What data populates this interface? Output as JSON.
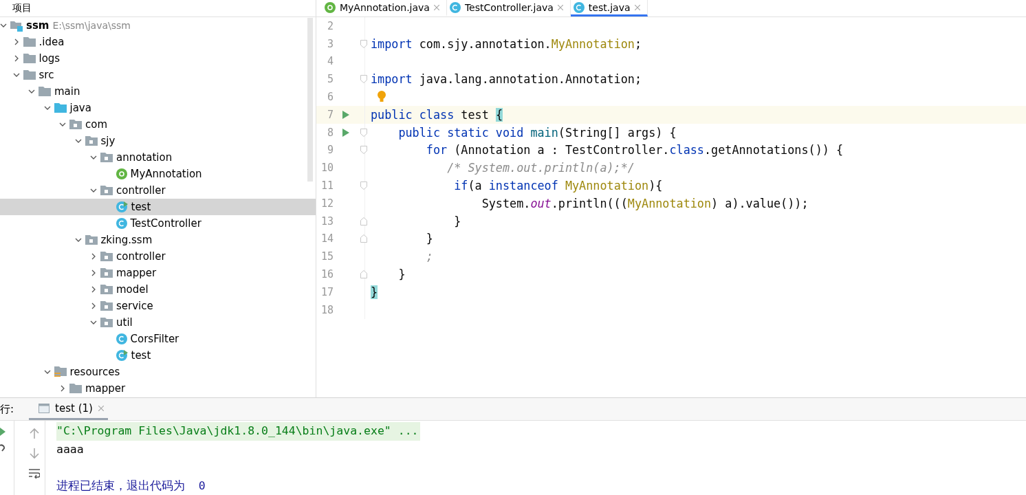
{
  "project_panel": {
    "title": "项目",
    "tree": [
      {
        "label": "ssm",
        "path": "E:\\ssm\\java\\ssm",
        "kind": "module",
        "expanded": true,
        "selected": false,
        "children": [
          {
            "label": ".idea",
            "kind": "folder",
            "expanded": false,
            "selected": false
          },
          {
            "label": "logs",
            "kind": "folder",
            "expanded": false,
            "selected": false
          },
          {
            "label": "src",
            "kind": "folder",
            "expanded": true,
            "selected": false,
            "children": [
              {
                "label": "main",
                "kind": "folder",
                "expanded": true,
                "selected": false,
                "children": [
                  {
                    "label": "java",
                    "kind": "source",
                    "expanded": true,
                    "selected": false,
                    "children": [
                      {
                        "label": "com",
                        "kind": "package",
                        "expanded": true,
                        "selected": false,
                        "children": [
                          {
                            "label": "sjy",
                            "kind": "package",
                            "expanded": true,
                            "selected": false,
                            "children": [
                              {
                                "label": "annotation",
                                "kind": "package",
                                "expanded": true,
                                "selected": false,
                                "children": [
                                  {
                                    "label": "MyAnnotation",
                                    "kind": "annotation",
                                    "selected": false
                                  }
                                ]
                              },
                              {
                                "label": "controller",
                                "kind": "package",
                                "expanded": true,
                                "selected": false,
                                "children": [
                                  {
                                    "label": "test",
                                    "kind": "runclass",
                                    "selected": true
                                  },
                                  {
                                    "label": "TestController",
                                    "kind": "class",
                                    "selected": false
                                  }
                                ]
                              }
                            ]
                          },
                          {
                            "label": "zking.ssm",
                            "kind": "package",
                            "expanded": true,
                            "selected": false,
                            "children": [
                              {
                                "label": "controller",
                                "kind": "package",
                                "expanded": false,
                                "selected": false
                              },
                              {
                                "label": "mapper",
                                "kind": "package",
                                "expanded": false,
                                "selected": false
                              },
                              {
                                "label": "model",
                                "kind": "package",
                                "expanded": false,
                                "selected": false
                              },
                              {
                                "label": "service",
                                "kind": "package",
                                "expanded": false,
                                "selected": false
                              },
                              {
                                "label": "util",
                                "kind": "package",
                                "expanded": true,
                                "selected": false,
                                "children": [
                                  {
                                    "label": "CorsFilter",
                                    "kind": "class",
                                    "selected": false
                                  },
                                  {
                                    "label": "test",
                                    "kind": "runclass",
                                    "selected": false
                                  }
                                ]
                              }
                            ]
                          }
                        ]
                      }
                    ]
                  },
                  {
                    "label": "resources",
                    "kind": "resources",
                    "expanded": true,
                    "selected": false,
                    "children": [
                      {
                        "label": "mapper",
                        "kind": "folder",
                        "expanded": false,
                        "selected": false
                      }
                    ]
                  }
                ]
              }
            ]
          }
        ]
      }
    ]
  },
  "editor_tabs": [
    {
      "label": "MyAnnotation.java",
      "kind": "annotation",
      "selected": false
    },
    {
      "label": "TestController.java",
      "kind": "class",
      "selected": false
    },
    {
      "label": "test.java",
      "kind": "class",
      "selected": true
    }
  ],
  "code": [
    {
      "number": "2",
      "kind": "plain"
    },
    {
      "number": "3",
      "kind": "fold-open",
      "tokens": [
        {
          "kind": "kw",
          "text": "import"
        },
        {
          "kind": "plain",
          "text": " com.sjy.annotation."
        },
        {
          "kind": "type",
          "text": "MyAnnotation"
        },
        {
          "kind": "plain",
          "text": ";"
        }
      ]
    },
    {
      "number": "4",
      "kind": "plain"
    },
    {
      "number": "5",
      "kind": "fold-open",
      "tokens": [
        {
          "kind": "kw",
          "text": "import"
        },
        {
          "kind": "plain",
          "text": " java.lang.annotation.Annotation;"
        }
      ]
    },
    {
      "number": "6",
      "kind": "plain",
      "bulb": true
    },
    {
      "number": "7",
      "kind": "plain",
      "run": true,
      "current": true,
      "tokens": [
        {
          "kind": "kw",
          "text": "public class "
        },
        {
          "kind": "plain",
          "text": "test "
        },
        {
          "kind": "brace",
          "text": "{"
        }
      ]
    },
    {
      "number": "8",
      "kind": "fold-open",
      "run": true,
      "tokens": [
        {
          "kind": "kw",
          "text": "    public static void "
        },
        {
          "kind": "method",
          "text": "main"
        },
        {
          "kind": "plain",
          "text": "(String[] args) {"
        }
      ]
    },
    {
      "number": "9",
      "kind": "fold-open",
      "tokens": [
        {
          "kind": "kw",
          "text": "        for"
        },
        {
          "kind": "plain",
          "text": " (Annotation a : TestController."
        },
        {
          "kind": "kw",
          "text": "class"
        },
        {
          "kind": "plain",
          "text": ".getAnnotations()) {"
        }
      ]
    },
    {
      "number": "10",
      "kind": "plain",
      "tokens": [
        {
          "kind": "comment",
          "text": "           /* System.out.println(a);*/"
        }
      ]
    },
    {
      "number": "11",
      "kind": "fold-open",
      "tokens": [
        {
          "kind": "kw",
          "text": "            if"
        },
        {
          "kind": "plain",
          "text": "(a "
        },
        {
          "kind": "kw",
          "text": "instanceof "
        },
        {
          "kind": "type",
          "text": "MyAnnotation"
        },
        {
          "kind": "plain",
          "text": "){"
        }
      ]
    },
    {
      "number": "12",
      "kind": "plain",
      "tokens": [
        {
          "kind": "plain",
          "text": "                System."
        },
        {
          "kind": "field",
          "text": "out"
        },
        {
          "kind": "plain",
          "text": ".println((("
        },
        {
          "kind": "type",
          "text": "MyAnnotation"
        },
        {
          "kind": "plain",
          "text": ") a).value());"
        }
      ]
    },
    {
      "number": "13",
      "kind": "fold-close",
      "tokens": [
        {
          "kind": "plain",
          "text": "            }"
        }
      ]
    },
    {
      "number": "14",
      "kind": "fold-close",
      "tokens": [
        {
          "kind": "plain",
          "text": "        }"
        }
      ]
    },
    {
      "number": "15",
      "kind": "plain",
      "tokens": [
        {
          "kind": "comment",
          "text": "        ;"
        }
      ]
    },
    {
      "number": "16",
      "kind": "fold-close",
      "tokens": [
        {
          "kind": "plain",
          "text": "    }"
        }
      ]
    },
    {
      "number": "17",
      "kind": "plain",
      "tokens": [
        {
          "kind": "brace",
          "text": "}"
        }
      ]
    },
    {
      "number": "18",
      "kind": "plain"
    }
  ],
  "run_panel": {
    "label": "行:",
    "tabs": [
      {
        "label": "test (1)",
        "selected": true
      }
    ],
    "console": [
      {
        "kind": "command",
        "text": "\"C:\\Program Files\\Java\\jdk1.8.0_144\\bin\\java.exe\" ..."
      },
      {
        "kind": "output",
        "text": "aaaa"
      },
      {
        "kind": "blank"
      },
      {
        "kind": "system",
        "text": "进程已结束，退出代码为  0"
      }
    ]
  }
}
